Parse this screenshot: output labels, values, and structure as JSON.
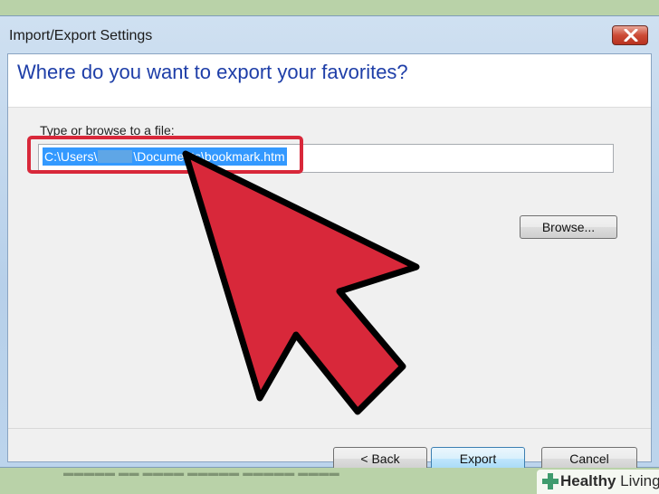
{
  "window": {
    "title": "Import/Export Settings",
    "close_icon": "close-icon"
  },
  "main": {
    "heading": "Where do you want to export your favorites?",
    "field_label": "Type or browse to a file:",
    "path_prefix": "C:\\Users\\",
    "path_suffix": "\\Documents\\bookmark.htm",
    "browse_label": "Browse..."
  },
  "footer": {
    "back_label": "< Back",
    "export_label": "Export",
    "cancel_label": "Cancel"
  },
  "annotation": {
    "highlight_color": "#d8283a",
    "arrow_color": "#d8283a"
  },
  "watermark": {
    "brand_bold": "Healthy",
    "brand_light": "Living",
    "cross_color": "#3f9b6e"
  }
}
